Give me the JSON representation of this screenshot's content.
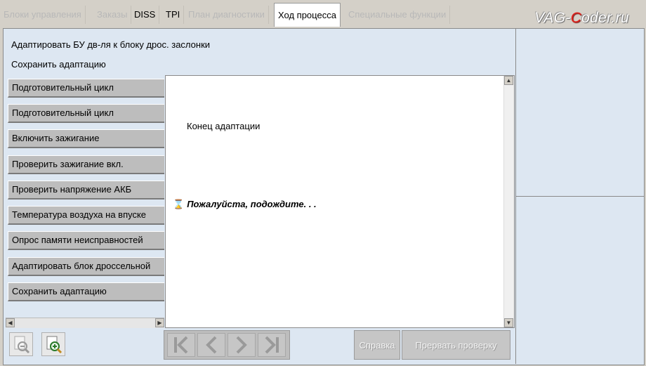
{
  "tabs": [
    {
      "label": "Блоки управления",
      "state": "disabled"
    },
    {
      "label": "Заказы",
      "state": "disabled"
    },
    {
      "label": "DISS",
      "state": "enabled"
    },
    {
      "label": "TPI",
      "state": "enabled"
    },
    {
      "label": "План диагностики",
      "state": "disabled"
    },
    {
      "label": "Ход процесса",
      "state": "active"
    },
    {
      "label": "Специальные функции",
      "state": "disabled"
    }
  ],
  "logo": {
    "part1": "VAG-",
    "highlight": "C",
    "part2": "oder.ru"
  },
  "header": {
    "line1": "Адаптировать БУ дв-ля к блоку дрос. заслонки",
    "line2": "Сохранить адаптацию"
  },
  "steps": [
    "Подготовительный цикл",
    "Подготовительный цикл",
    "Включить зажигание",
    "Проверить зажигание вкл.",
    "Проверить напряжение АКБ",
    "Температура воздуха на впуске",
    "Опрос памяти неисправностей",
    "Адаптировать блок дроссельной",
    "Сохранить адаптацию"
  ],
  "content": {
    "message": "Конец адаптации",
    "wait_text": "Пожалуйста, подождите. . .",
    "wait_icon": "hourglass-icon"
  },
  "bottom": {
    "help_label": "Справка",
    "abort_label": "Прервать проверку",
    "zoom_out_icon": "zoom-out-icon",
    "zoom_in_icon": "zoom-in-icon",
    "nav_icons": [
      "first-icon",
      "prev-icon",
      "next-icon",
      "last-icon"
    ]
  },
  "colors": {
    "panel_bg": "#dde7f2",
    "step_bg": "#bdbdbd",
    "logo_accent": "#e0201a"
  }
}
